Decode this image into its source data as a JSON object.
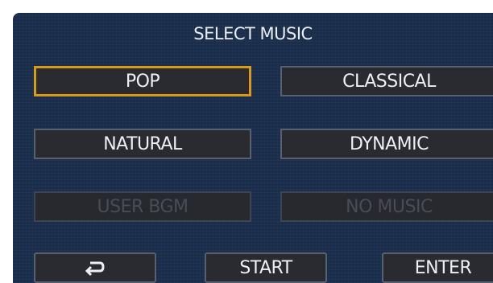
{
  "screen": {
    "title": "SELECT MUSIC"
  },
  "options": {
    "pop": "POP",
    "classical": "CLASSICAL",
    "natural": "NATURAL",
    "dynamic": "DYNAMIC",
    "user_bgm": "USER BGM",
    "no_music": "NO MUSIC"
  },
  "footer": {
    "back_icon": "return-arrow-icon",
    "start_label": "START",
    "enter_label": "ENTER"
  },
  "colors": {
    "background": "#1a2d4b",
    "selected_border": "#d99a17",
    "button_fill": "#2a2b30"
  },
  "selected_option": "POP"
}
